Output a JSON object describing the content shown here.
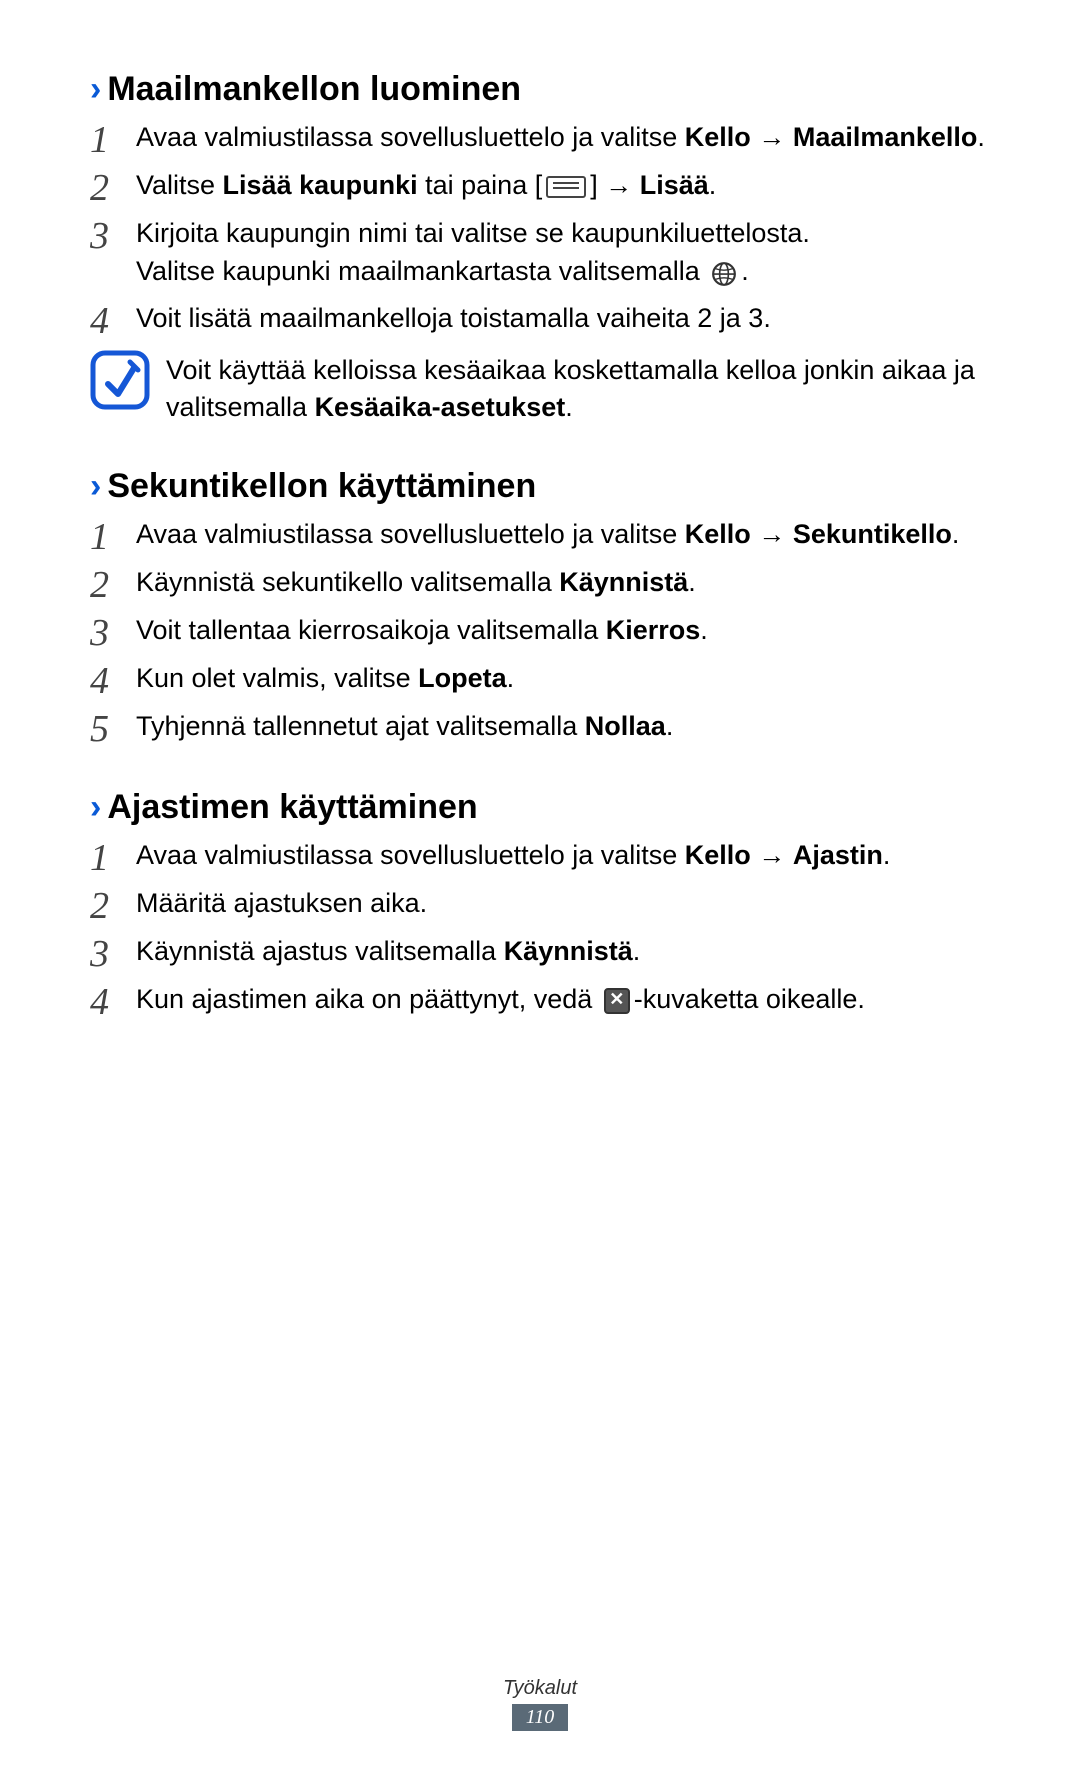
{
  "sections": [
    {
      "chevron": "›",
      "title": "Maailmankellon luominen",
      "steps": [
        {
          "num": "1",
          "pre": "Avaa valmiustilassa sovellusluettelo ja valitse ",
          "b1": "Kello",
          "mid": " ",
          "arrow1": "→",
          "post1": " ",
          "b2": "Maailmankello",
          "tail": "."
        },
        {
          "num": "2",
          "pre": "Valitse ",
          "b1": "Lisää kaupunki",
          "mid": " tai paina [",
          "icon": "menu",
          "post1": "] ",
          "arrow1": "→",
          "post2": " ",
          "b2": "Lisää",
          "tail": "."
        },
        {
          "num": "3",
          "line1": "Kirjoita kaupungin nimi tai valitse se kaupunkiluettelosta.",
          "line2pre": "Valitse kaupunki maailmankartasta valitsemalla ",
          "icon": "globe",
          "line2tail": "."
        },
        {
          "num": "4",
          "plain": "Voit lisätä maailmankelloja toistamalla vaiheita 2 ja 3."
        }
      ],
      "note": {
        "pre": "Voit käyttää kelloissa kesäaikaa koskettamalla kelloa jonkin aikaa ja valitsemalla ",
        "b": "Kesäaika-asetukset",
        "tail": "."
      }
    },
    {
      "chevron": "›",
      "title": "Sekuntikellon käyttäminen",
      "steps": [
        {
          "num": "1",
          "pre": "Avaa valmiustilassa sovellusluettelo ja valitse ",
          "b1": "Kello",
          "mid": " ",
          "arrow1": "→",
          "post1": " ",
          "b2": "Sekuntikello",
          "tail": "."
        },
        {
          "num": "2",
          "pre": "Käynnistä sekuntikello valitsemalla ",
          "b1": "Käynnistä",
          "tail": "."
        },
        {
          "num": "3",
          "pre": "Voit tallentaa kierrosaikoja valitsemalla ",
          "b1": "Kierros",
          "tail": "."
        },
        {
          "num": "4",
          "pre": "Kun olet valmis, valitse ",
          "b1": "Lopeta",
          "tail": "."
        },
        {
          "num": "5",
          "pre": "Tyhjennä tallennetut ajat valitsemalla ",
          "b1": "Nollaa",
          "tail": "."
        }
      ]
    },
    {
      "chevron": "›",
      "title": "Ajastimen käyttäminen",
      "steps": [
        {
          "num": "1",
          "pre": "Avaa valmiustilassa sovellusluettelo ja valitse ",
          "b1": "Kello",
          "mid": " ",
          "arrow1": "→",
          "post1": " ",
          "b2": "Ajastin",
          "tail": "."
        },
        {
          "num": "2",
          "plain": "Määritä ajastuksen aika."
        },
        {
          "num": "3",
          "pre": "Käynnistä ajastus valitsemalla ",
          "b1": "Käynnistä",
          "tail": "."
        },
        {
          "num": "4",
          "pre": "Kun ajastimen aika on päättynyt, vedä ",
          "icon": "x",
          "tail": "-kuvaketta oikealle."
        }
      ]
    }
  ],
  "footer": {
    "label": "Työkalut",
    "page": "110"
  }
}
